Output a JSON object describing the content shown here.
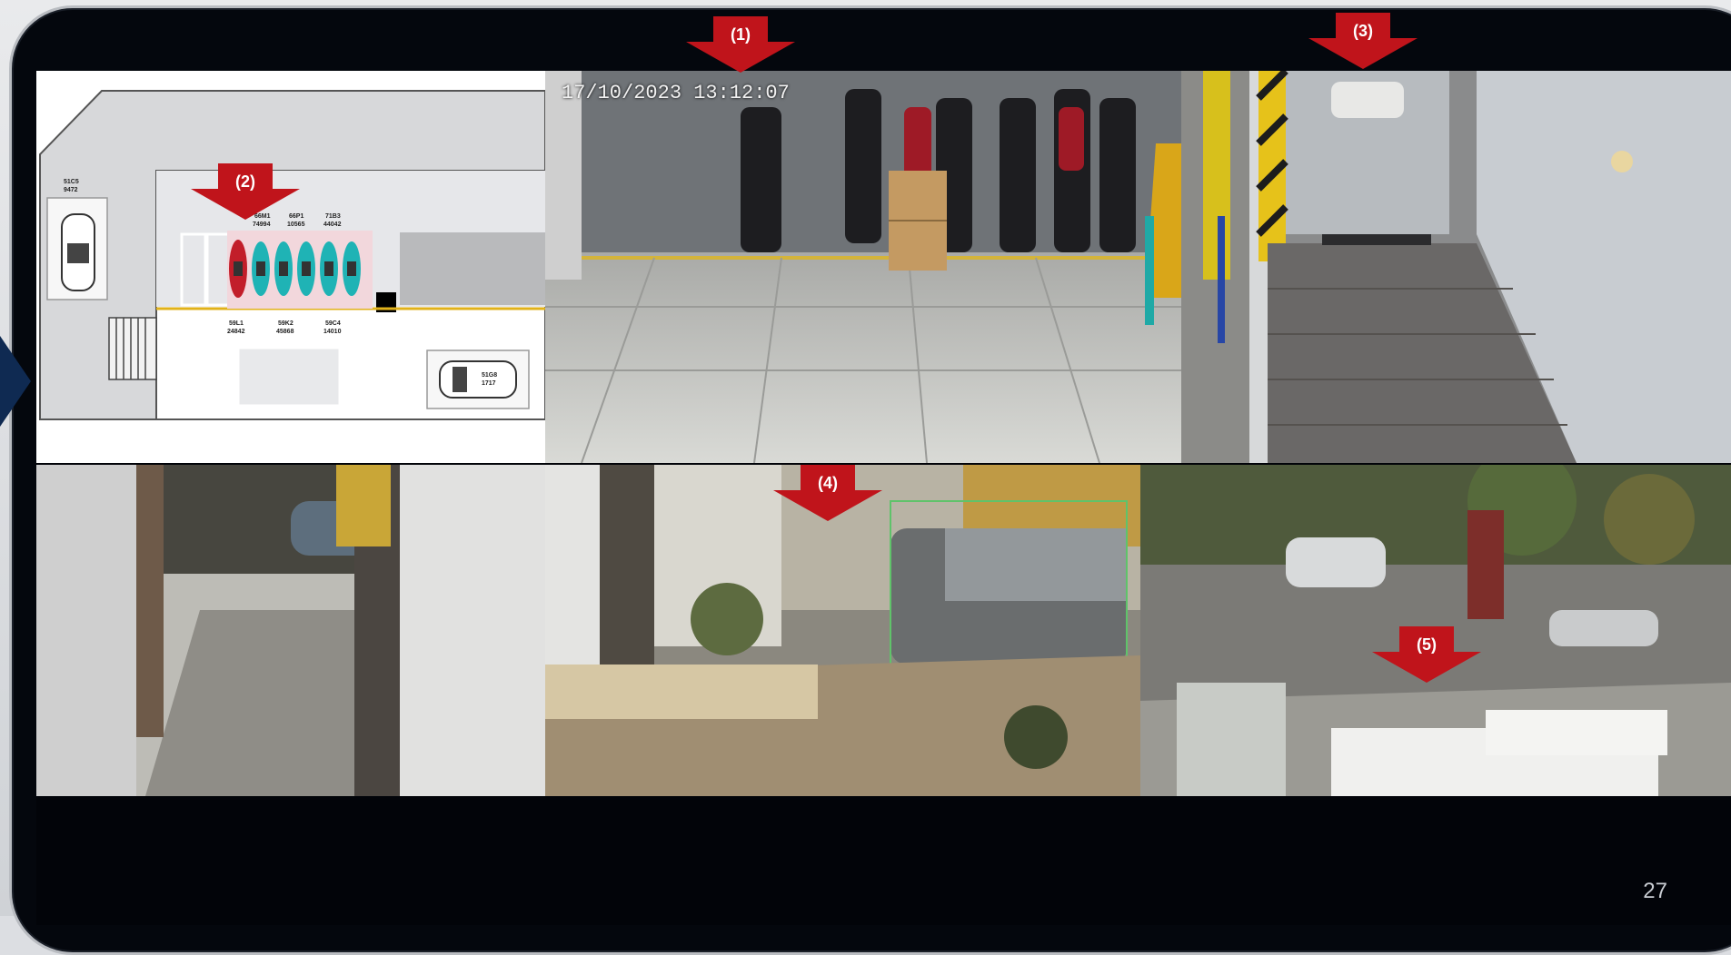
{
  "camera_1": {
    "timestamp": "17/10/2023  13:12:07"
  },
  "markers": [
    {
      "label": "(1)"
    },
    {
      "label": "(2)"
    },
    {
      "label": "(3)"
    },
    {
      "label": "(4)"
    },
    {
      "label": "(5)"
    }
  ],
  "parking_map": {
    "labels": {
      "car_left_plate_1": "51C5",
      "car_left_plate_2": "9472",
      "car_right_plate_1": "51G8",
      "car_right_plate_2": "1717",
      "top_1a": "66M1",
      "top_1b": "74994",
      "top_2a": "66P1",
      "top_2b": "10565",
      "top_3a": "71B3",
      "top_3b": "44042",
      "bot_1a": "59L1",
      "bot_1b": "24842",
      "bot_2a": "59K2",
      "bot_2b": "45868",
      "bot_3a": "59C4",
      "bot_3b": "14010"
    }
  },
  "page_number": "27",
  "colors": {
    "marker_red": "#c0141b",
    "motorbike_teal": "#1fb3b5",
    "motorbike_highlight": "#c21e2a"
  }
}
